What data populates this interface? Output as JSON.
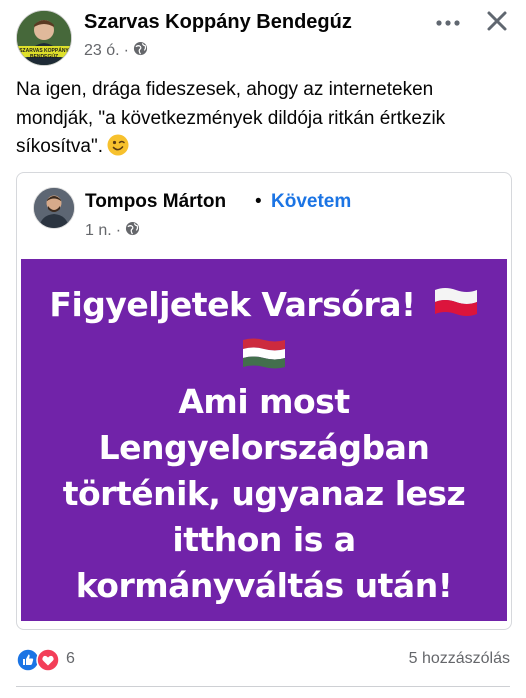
{
  "post": {
    "author": "Szarvas Koppány Bendegúz",
    "avatar_banner_text": "SZARVAS KOPPÁNY BENDEGÚZ",
    "time": "23 ó.",
    "privacy_icon": "globe-icon",
    "more_icon": "more-horizontal-icon",
    "close_icon": "close-icon",
    "text": "Na igen, drága fideszesek, ahogy az interneteken mondják, \"a következmények dildója ritkán értkezik síkosítva\".",
    "emoji": "winking-face-emoji"
  },
  "shared": {
    "author": "Tompos Márton",
    "separator": "•",
    "follow_label": "Követem",
    "time": "1 n.",
    "image": {
      "background_color": "#7123a9",
      "headline": "Figyeljetek Varsóra!",
      "lines": [
        "Ami most",
        "Lengyelországban",
        "történik, ugyanaz lesz",
        "itthon is a",
        "kormányváltás után!"
      ],
      "flags": [
        "poland-flag-emoji",
        "hungary-flag-emoji"
      ]
    }
  },
  "footer": {
    "reaction_icons": [
      "like-icon",
      "love-icon"
    ],
    "reaction_count": "6",
    "comment_count": "5 hozzászólás"
  },
  "colors": {
    "link_blue": "#1b74e4",
    "secondary_text": "#65676b",
    "divider": "#ced0d4"
  }
}
